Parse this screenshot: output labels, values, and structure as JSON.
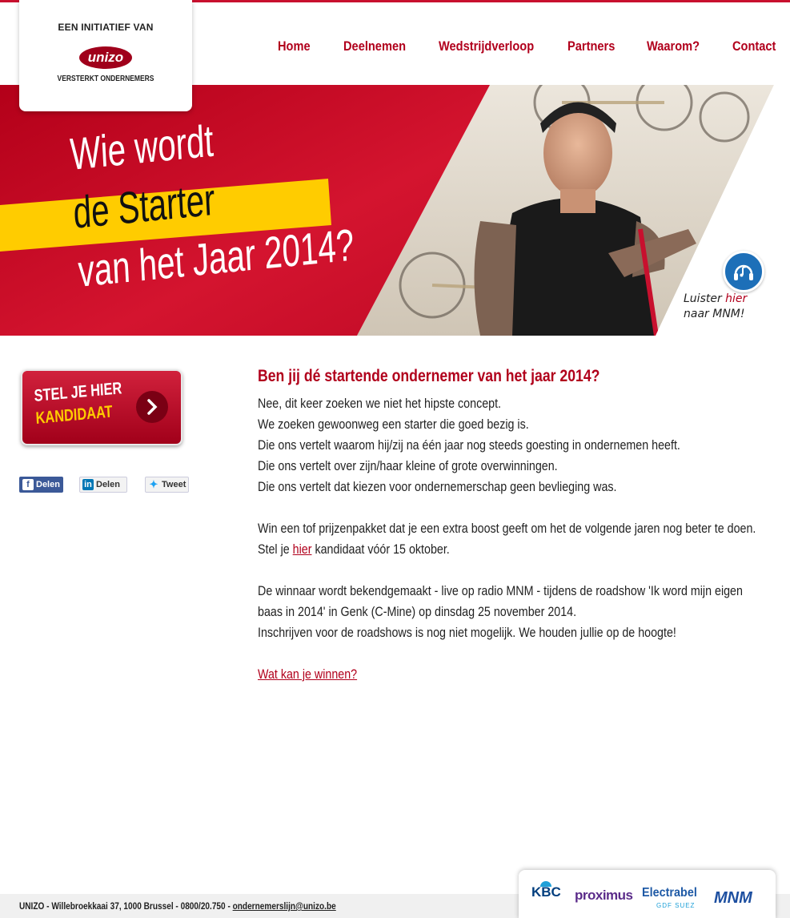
{
  "logo": {
    "top_line": "EEN INITIATIEF VAN",
    "brand": "unizo",
    "bottom_line": "VERSTERKT ONDERNEMERS"
  },
  "nav": {
    "items": [
      {
        "label": "Home"
      },
      {
        "label": "Deelnemen"
      },
      {
        "label": "Wedstrijdverloop"
      },
      {
        "label": "Partners"
      },
      {
        "label": "Waarom?"
      },
      {
        "label": "Contact"
      }
    ]
  },
  "hero": {
    "line1": "Wie wordt",
    "line2": "de Starter",
    "line3": "van het Jaar 2014?",
    "listen_line1_prefix": "Luister ",
    "listen_line1_link": "hier",
    "listen_line2": "naar MNM!",
    "listen_icon": "headphones-music-icon"
  },
  "sidebar": {
    "cta_line1": "STEL JE HIER",
    "cta_line2": "KANDIDAAT",
    "share_facebook": "Delen",
    "share_linkedin": "Delen",
    "share_twitter": "Tweet"
  },
  "content": {
    "title": "Ben jij dé startende ondernemer van het jaar 2014?",
    "para1": [
      "Nee, dit keer zoeken we niet het hipste concept.",
      "We zoeken gewoonweg een starter die goed bezig is.",
      "Die ons vertelt waarom hij/zij na één jaar nog steeds goesting in ondernemen heeft.",
      "Die ons vertelt over zijn/haar kleine of grote overwinningen.",
      "Die ons vertelt dat kiezen voor ondernemerschap geen bevlieging was."
    ],
    "para2_line1": "Win een tof prijzenpakket dat je een extra boost geeft om het de volgende jaren nog beter te doen.",
    "para2_prefix": "Stel je ",
    "para2_link": "hier",
    "para2_suffix": " kandidaat vóór 15 oktober.",
    "para3_line1": "De winnaar wordt bekendgemaakt - live op radio MNM - tijdens de roadshow 'Ik word mijn eigen",
    "para3_line2": "baas in 2014' in Genk (C-Mine) op dinsdag 25 november 2014.",
    "para3_line3": "Inschrijven voor de roadshows is nog niet mogelijk. We houden jullie op de hoogte!",
    "prize_link": "Wat kan je winnen?"
  },
  "footer": {
    "address": "UNIZO - Willebroekkaai 37, 1000 Brussel - 0800/20.750 - ",
    "email": "ondernemerslijn@unizo.be"
  },
  "partners": {
    "kbc": "KBC",
    "proximus": "proximus",
    "electrabel": "Electrabel",
    "electrabel_sub": "GDF SUEZ",
    "mnm": "MNM"
  },
  "colors": {
    "brand_red": "#b1001c",
    "hero_red": "#c8102e",
    "highlight_yellow": "#ffcc00",
    "mnm_blue": "#1d6fb8"
  }
}
